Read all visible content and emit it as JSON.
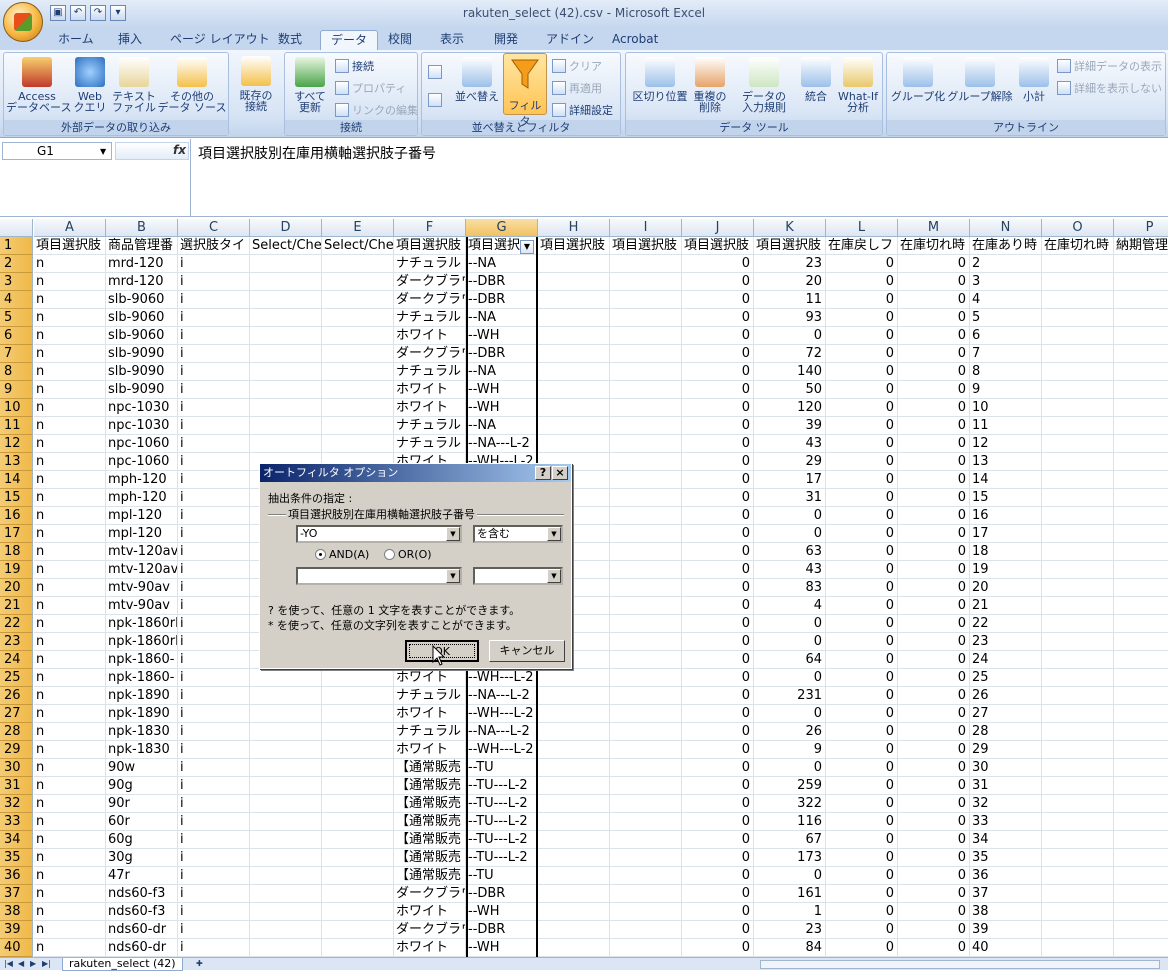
{
  "window": {
    "title": "rakuten_select (42).csv - Microsoft Excel"
  },
  "tabs": [
    "ホーム",
    "挿入",
    "ページ レイアウト",
    "数式",
    "データ",
    "校閲",
    "表示",
    "開発",
    "アドイン",
    "Acrobat"
  ],
  "active_tab": "データ",
  "ribbon": {
    "group_external": {
      "label": "外部データの取り込み",
      "access": "Access\nデータベース",
      "web": "Web\nクエリ",
      "text": "テキスト\nファイル",
      "other": "その他の\nデータ ソース"
    },
    "existing": "既存の\n接続",
    "group_connections": {
      "label": "接続",
      "refresh_all": "すべて\n更新",
      "connections": "接続",
      "properties": "プロパティ",
      "edit_links": "リンクの編集"
    },
    "group_sort": {
      "label": "並べ替えとフィルタ",
      "sort": "並べ替え",
      "filter": "フィルタ",
      "clear": "クリア",
      "reapply": "再適用",
      "advanced": "詳細設定"
    },
    "group_tools": {
      "label": "データ ツール",
      "text_to_columns": "区切り位置",
      "remove_dup": "重複の\n削除",
      "validation": "データの\n入力規則",
      "consolidate": "統合",
      "whatif": "What-If\n分析"
    },
    "group_outline": {
      "label": "アウトライン",
      "group": "グループ化",
      "ungroup": "グループ解除",
      "subtotal": "小計",
      "show_detail": "詳細データの表示",
      "hide_detail": "詳細を表示しない"
    }
  },
  "formula_bar": {
    "name_box": "G1",
    "fx": "fx",
    "value": "項目選択肢別在庫用横軸選択肢子番号"
  },
  "columns": [
    "A",
    "B",
    "C",
    "D",
    "E",
    "F",
    "G",
    "H",
    "I",
    "J",
    "K",
    "L",
    "M",
    "N",
    "O",
    "P"
  ],
  "header_row": [
    "項目選択肢",
    "商品管理番",
    "選択肢タイ",
    "Select/Che",
    "Select/Che",
    "項目選択肢",
    "項目選択",
    "項目選択肢",
    "項目選択肢",
    "項目選択肢",
    "項目選択肢",
    "在庫戻しフ",
    "在庫切れ時",
    "在庫あり時",
    "在庫切れ時",
    "納期管理"
  ],
  "rows": [
    {
      "n": "2",
      "a": "n",
      "b": "mrd-120",
      "c": "i",
      "f": "ナチュラル",
      "g": "--NA",
      "j": "0",
      "k": "23",
      "l": "0",
      "m": "0"
    },
    {
      "n": "3",
      "a": "n",
      "b": "mrd-120",
      "c": "i",
      "f": "ダークブラウ",
      "g": "--DBR",
      "j": "0",
      "k": "20",
      "l": "0",
      "m": "0"
    },
    {
      "n": "4",
      "a": "n",
      "b": "slb-9060",
      "c": "i",
      "f": "ダークブラウ",
      "g": "--DBR",
      "j": "0",
      "k": "11",
      "l": "0",
      "m": "0"
    },
    {
      "n": "5",
      "a": "n",
      "b": "slb-9060",
      "c": "i",
      "f": "ナチュラル",
      "g": "--NA",
      "j": "0",
      "k": "93",
      "l": "0",
      "m": "0"
    },
    {
      "n": "6",
      "a": "n",
      "b": "slb-9060",
      "c": "i",
      "f": "ホワイト",
      "g": "--WH",
      "j": "0",
      "k": "0",
      "l": "0",
      "m": "0"
    },
    {
      "n": "7",
      "a": "n",
      "b": "slb-9090",
      "c": "i",
      "f": "ダークブラウ",
      "g": "--DBR",
      "j": "0",
      "k": "72",
      "l": "0",
      "m": "0"
    },
    {
      "n": "8",
      "a": "n",
      "b": "slb-9090",
      "c": "i",
      "f": "ナチュラル",
      "g": "--NA",
      "j": "0",
      "k": "140",
      "l": "0",
      "m": "0"
    },
    {
      "n": "9",
      "a": "n",
      "b": "slb-9090",
      "c": "i",
      "f": "ホワイト",
      "g": "--WH",
      "j": "0",
      "k": "50",
      "l": "0",
      "m": "0"
    },
    {
      "n": "10",
      "a": "n",
      "b": "npc-1030",
      "c": "i",
      "f": "ホワイト",
      "g": "--WH",
      "j": "0",
      "k": "120",
      "l": "0",
      "m": "0"
    },
    {
      "n": "11",
      "a": "n",
      "b": "npc-1030",
      "c": "i",
      "f": "ナチュラル",
      "g": "--NA",
      "j": "0",
      "k": "39",
      "l": "0",
      "m": "0"
    },
    {
      "n": "12",
      "a": "n",
      "b": "npc-1060",
      "c": "i",
      "f": "ナチュラル",
      "g": "--NA---L-2",
      "j": "0",
      "k": "43",
      "l": "0",
      "m": "0"
    },
    {
      "n": "13",
      "a": "n",
      "b": "npc-1060",
      "c": "i",
      "f": "ホワイト",
      "g": "--WH---L-2",
      "j": "0",
      "k": "29",
      "l": "0",
      "m": "0"
    },
    {
      "n": "14",
      "a": "n",
      "b": "mph-120",
      "c": "i",
      "f": "",
      "g": "",
      "j": "0",
      "k": "17",
      "l": "0",
      "m": "0"
    },
    {
      "n": "15",
      "a": "n",
      "b": "mph-120",
      "c": "i",
      "f": "",
      "g": "",
      "j": "0",
      "k": "31",
      "l": "0",
      "m": "0"
    },
    {
      "n": "16",
      "a": "n",
      "b": "mpl-120",
      "c": "i",
      "f": "",
      "g": "",
      "j": "0",
      "k": "0",
      "l": "0",
      "m": "0"
    },
    {
      "n": "17",
      "a": "n",
      "b": "mpl-120",
      "c": "i",
      "f": "",
      "g": "",
      "j": "0",
      "k": "0",
      "l": "0",
      "m": "0"
    },
    {
      "n": "18",
      "a": "n",
      "b": "mtv-120av",
      "c": "i",
      "f": "",
      "g": "",
      "j": "0",
      "k": "63",
      "l": "0",
      "m": "0"
    },
    {
      "n": "19",
      "a": "n",
      "b": "mtv-120av",
      "c": "i",
      "f": "",
      "g": "",
      "j": "0",
      "k": "43",
      "l": "0",
      "m": "0"
    },
    {
      "n": "20",
      "a": "n",
      "b": "mtv-90av",
      "c": "i",
      "f": "",
      "g": "",
      "j": "0",
      "k": "83",
      "l": "0",
      "m": "0"
    },
    {
      "n": "21",
      "a": "n",
      "b": "mtv-90av",
      "c": "i",
      "f": "",
      "g": "",
      "j": "0",
      "k": "4",
      "l": "0",
      "m": "0"
    },
    {
      "n": "22",
      "a": "n",
      "b": "npk-1860rl",
      "c": "i",
      "f": "",
      "g": "",
      "j": "0",
      "k": "0",
      "l": "0",
      "m": "0"
    },
    {
      "n": "23",
      "a": "n",
      "b": "npk-1860rl",
      "c": "i",
      "f": "",
      "g": "",
      "j": "0",
      "k": "0",
      "l": "0",
      "m": "0"
    },
    {
      "n": "24",
      "a": "n",
      "b": "npk-1860-",
      "c": "i",
      "f": "",
      "g": "",
      "j": "0",
      "k": "64",
      "l": "0",
      "m": "0"
    },
    {
      "n": "25",
      "a": "n",
      "b": "npk-1860-",
      "c": "i",
      "f": "ホワイト",
      "g": "--WH---L-2",
      "j": "0",
      "k": "0",
      "l": "0",
      "m": "0"
    },
    {
      "n": "26",
      "a": "n",
      "b": "npk-1890",
      "c": "i",
      "f": "ナチュラル",
      "g": "--NA---L-2",
      "j": "0",
      "k": "231",
      "l": "0",
      "m": "0"
    },
    {
      "n": "27",
      "a": "n",
      "b": "npk-1890",
      "c": "i",
      "f": "ホワイト",
      "g": "--WH---L-2",
      "j": "0",
      "k": "0",
      "l": "0",
      "m": "0"
    },
    {
      "n": "28",
      "a": "n",
      "b": "npk-1830",
      "c": "i",
      "f": "ナチュラル",
      "g": "--NA---L-2",
      "j": "0",
      "k": "26",
      "l": "0",
      "m": "0"
    },
    {
      "n": "29",
      "a": "n",
      "b": "npk-1830",
      "c": "i",
      "f": "ホワイト",
      "g": "--WH---L-2",
      "j": "0",
      "k": "9",
      "l": "0",
      "m": "0"
    },
    {
      "n": "30",
      "a": "n",
      "b": "90w",
      "c": "i",
      "f": "【通常販売",
      "g": "--TU",
      "j": "0",
      "k": "0",
      "l": "0",
      "m": "0"
    },
    {
      "n": "31",
      "a": "n",
      "b": "90g",
      "c": "i",
      "f": "【通常販売",
      "g": "--TU---L-2",
      "j": "0",
      "k": "259",
      "l": "0",
      "m": "0"
    },
    {
      "n": "32",
      "a": "n",
      "b": "90r",
      "c": "i",
      "f": "【通常販売",
      "g": "--TU---L-2",
      "j": "0",
      "k": "322",
      "l": "0",
      "m": "0"
    },
    {
      "n": "33",
      "a": "n",
      "b": "60r",
      "c": "i",
      "f": "【通常販売",
      "g": "--TU---L-2",
      "j": "0",
      "k": "116",
      "l": "0",
      "m": "0"
    },
    {
      "n": "34",
      "a": "n",
      "b": "60g",
      "c": "i",
      "f": "【通常販売",
      "g": "--TU---L-2",
      "j": "0",
      "k": "67",
      "l": "0",
      "m": "0"
    },
    {
      "n": "35",
      "a": "n",
      "b": "30g",
      "c": "i",
      "f": "【通常販売",
      "g": "--TU---L-2",
      "j": "0",
      "k": "173",
      "l": "0",
      "m": "0"
    },
    {
      "n": "36",
      "a": "n",
      "b": "47r",
      "c": "i",
      "f": "【通常販売",
      "g": "--TU",
      "j": "0",
      "k": "0",
      "l": "0",
      "m": "0"
    },
    {
      "n": "37",
      "a": "n",
      "b": "nds60-f3",
      "c": "i",
      "f": "ダークブラウ",
      "g": "--DBR",
      "j": "0",
      "k": "161",
      "l": "0",
      "m": "0"
    },
    {
      "n": "38",
      "a": "n",
      "b": "nds60-f3",
      "c": "i",
      "f": "ホワイト",
      "g": "--WH",
      "j": "0",
      "k": "1",
      "l": "0",
      "m": "0"
    },
    {
      "n": "39",
      "a": "n",
      "b": "nds60-dr",
      "c": "i",
      "f": "ダークブラウ",
      "g": "--DBR",
      "j": "0",
      "k": "23",
      "l": "0",
      "m": "0"
    },
    {
      "n": "40",
      "a": "n",
      "b": "nds60-dr",
      "c": "i",
      "f": "ホワイト",
      "g": "--WH",
      "j": "0",
      "k": "84",
      "l": "0",
      "m": "0"
    }
  ],
  "dialog": {
    "title": "オートフィルタ オプション",
    "help": "?",
    "close": "×",
    "criteria_label": "抽出条件の指定 :",
    "field_name": "項目選択肢別在庫用横軸選択肢子番号",
    "value1": "-YO",
    "operator1": "を含む",
    "and_label": "AND(A)",
    "or_label": "OR(O)",
    "value2": "",
    "operator2": "",
    "hint1": "? を使って、任意の 1 文字を表すことができます。",
    "hint2": "* を使って、任意の文字列を表すことができます。",
    "ok": "OK",
    "cancel": "キャンセル"
  },
  "status": {
    "sheet_tab": "rakuten_select (42)"
  }
}
